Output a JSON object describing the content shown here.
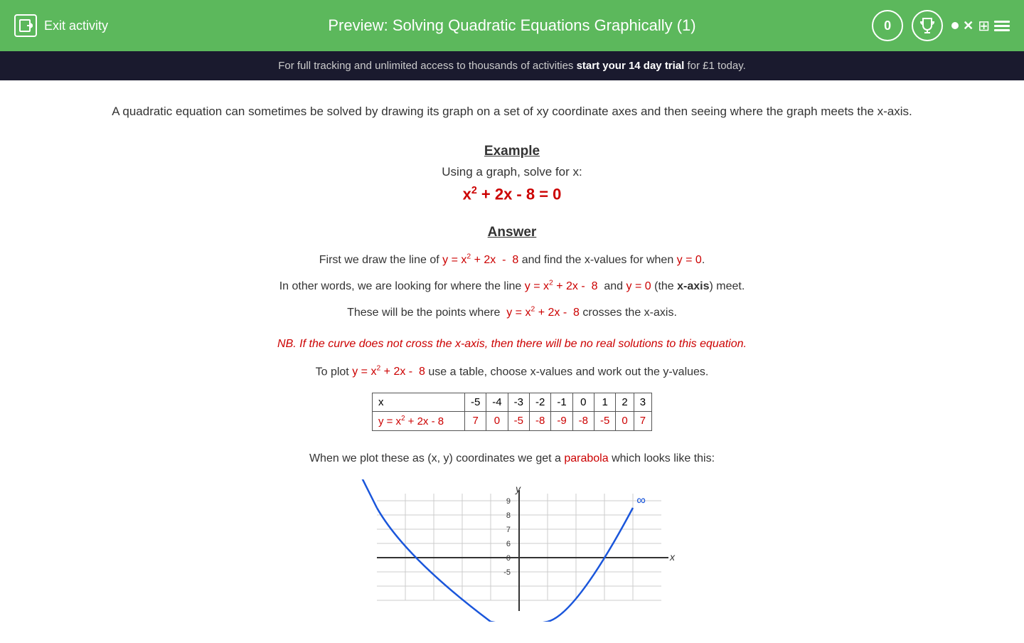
{
  "header": {
    "exit_label": "Exit activity",
    "title": "Preview: Solving Quadratic Equations Graphically (1)",
    "score": "0"
  },
  "banner": {
    "text_before": "For full tracking and unlimited access to thousands of activities ",
    "cta": "start your 14 day trial",
    "text_after": " for £1 today."
  },
  "main": {
    "intro": "A quadratic equation can sometimes be solved by drawing its graph on a set of xy coordinate axes and then seeing where the graph meets the x-axis.",
    "example": {
      "heading": "Example",
      "subtext": "Using a graph, solve for x:",
      "equation": "x² + 2x - 8 = 0"
    },
    "answer": {
      "heading": "Answer",
      "line1_before": "First we draw the line of",
      "line1_eq": "y = x² + 2x -  8",
      "line1_after": "and find the x-values for when",
      "line1_y": "y = 0",
      "line1_end": ".",
      "line2_before": "In other words, we are looking for where the line",
      "line2_eq": "y = x² + 2x -  8",
      "line2_and": "and",
      "line2_y": "y = 0",
      "line2_after": "(the x-axis) meet.",
      "line3_before": "These will be the points where",
      "line3_eq": "y = x² + 2x -  8",
      "line3_after": "crosses the x-axis.",
      "nb": "NB.  If the curve does not cross the x-axis, then there will be no real solutions to this equation.",
      "plot_before": "To plot",
      "plot_eq": "y = x² + 2x -  8",
      "plot_after": "use a table, choose x-values and work out the y-values."
    },
    "table": {
      "x_label": "x",
      "y_label": "y = x² + 2x - 8",
      "x_values": [
        "-5",
        "-4",
        "-3",
        "-2",
        "-1",
        "0",
        "1",
        "2",
        "3"
      ],
      "y_values": [
        "7",
        "0",
        "-5",
        "-8",
        "-9",
        "-8",
        "-5",
        "0",
        "7"
      ]
    },
    "parabola_text_before": "When we plot these as (x, y) coordinates we get a",
    "parabola_word": "parabola",
    "parabola_text_after": "which looks like this:"
  }
}
